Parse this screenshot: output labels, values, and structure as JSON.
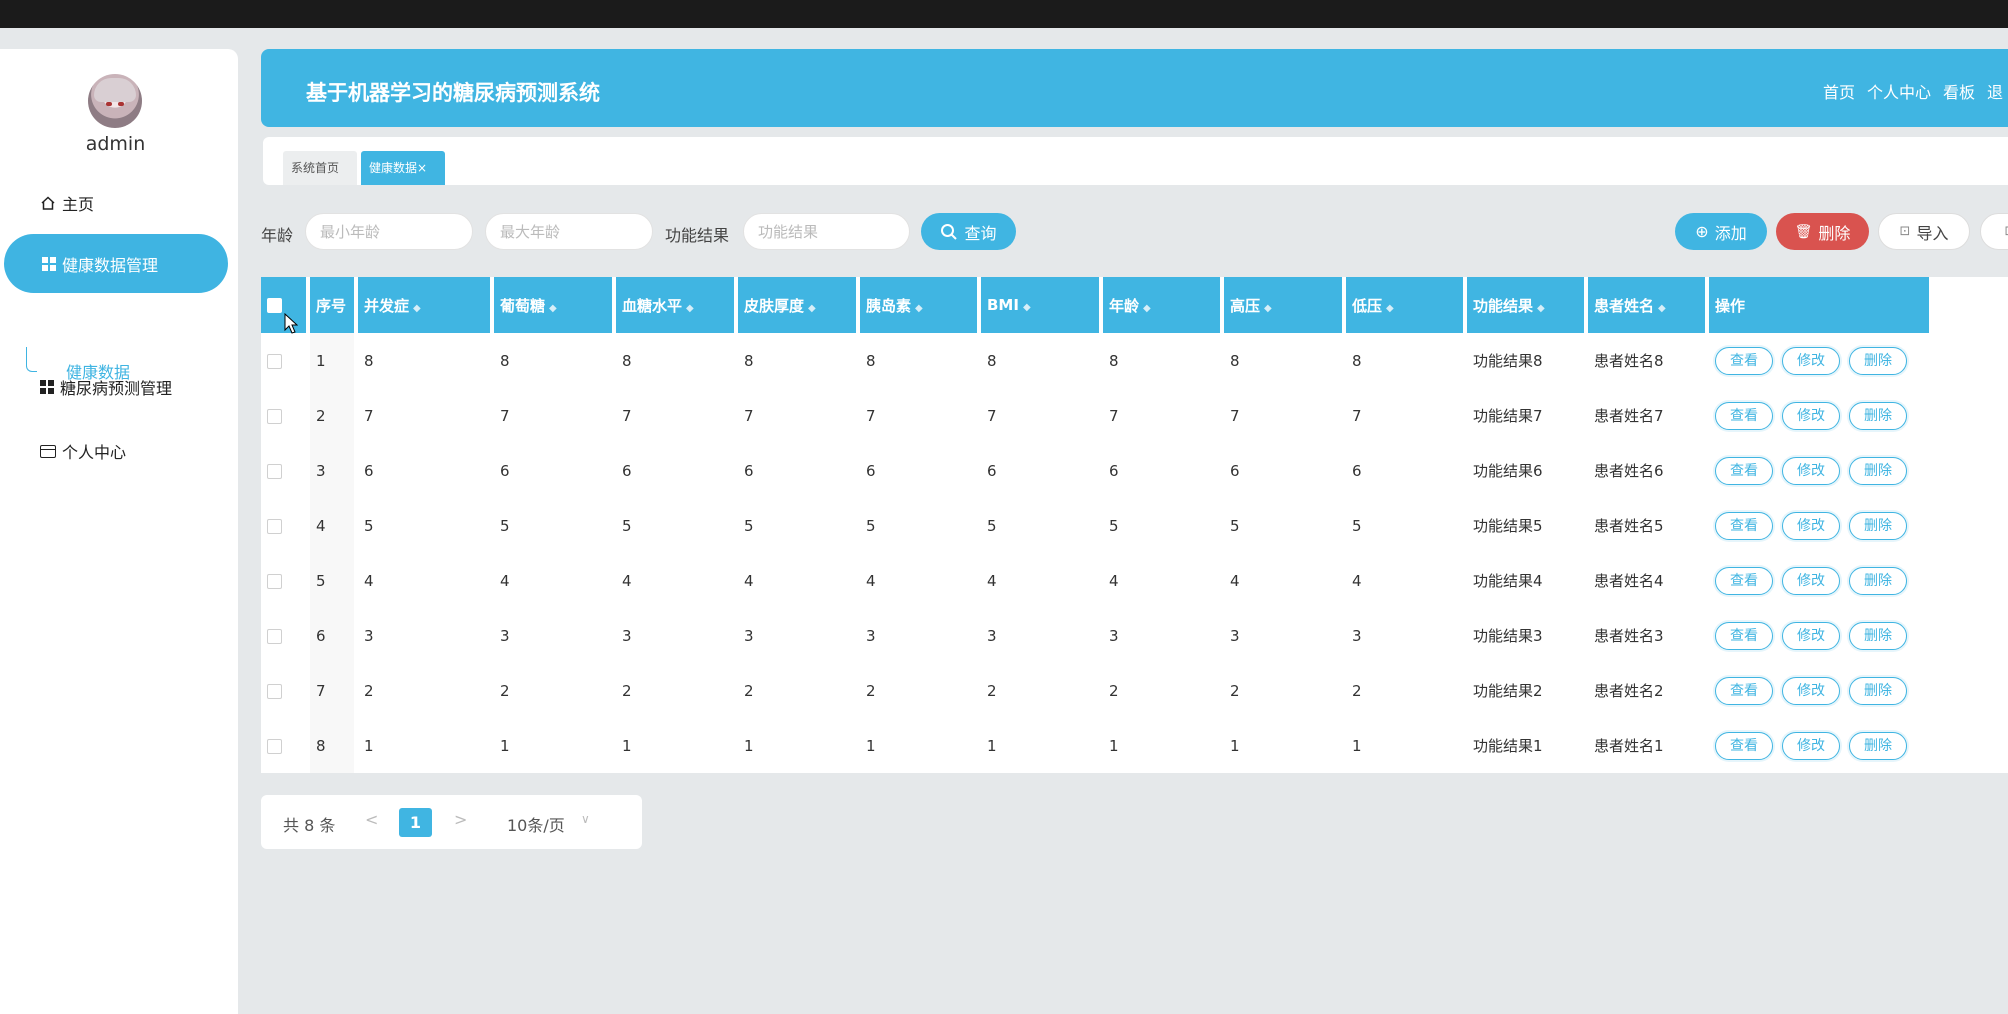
{
  "app": {
    "title": "基于机器学习的糖尿病预测系统",
    "nav": [
      "首页",
      "个人中心",
      "看板",
      "退"
    ]
  },
  "user": {
    "name": "admin"
  },
  "sidebar": {
    "items": [
      {
        "label": "主页",
        "icon": "home-icon"
      },
      {
        "label": "健康数据管理",
        "icon": "grid-icon",
        "active": true
      },
      {
        "label": "糖尿病预测管理",
        "icon": "grid-icon"
      },
      {
        "label": "个人中心",
        "icon": "card-icon"
      }
    ],
    "sub_item": "健康数据"
  },
  "tabs": [
    {
      "label": "系统首页"
    },
    {
      "label": "健康数据",
      "close": "×"
    }
  ],
  "filters": {
    "age_label": "年龄",
    "age_min_placeholder": "最小年龄",
    "age_max_placeholder": "最大年龄",
    "result_label": "功能结果",
    "result_placeholder": "功能结果",
    "query_label": "查询"
  },
  "actions": {
    "add": "添加",
    "delete": "删除",
    "import": "导入"
  },
  "table": {
    "columns": [
      "序号",
      "并发症",
      "葡萄糖",
      "血糖水平",
      "皮肤厚度",
      "胰岛素",
      "BMI",
      "年龄",
      "高压",
      "低压",
      "功能结果",
      "患者姓名",
      "操作"
    ],
    "rows": [
      [
        "1",
        "8",
        "8",
        "8",
        "8",
        "8",
        "8",
        "8",
        "8",
        "8",
        "功能结果8",
        "患者姓名8"
      ],
      [
        "2",
        "7",
        "7",
        "7",
        "7",
        "7",
        "7",
        "7",
        "7",
        "7",
        "功能结果7",
        "患者姓名7"
      ],
      [
        "3",
        "6",
        "6",
        "6",
        "6",
        "6",
        "6",
        "6",
        "6",
        "6",
        "功能结果6",
        "患者姓名6"
      ],
      [
        "4",
        "5",
        "5",
        "5",
        "5",
        "5",
        "5",
        "5",
        "5",
        "5",
        "功能结果5",
        "患者姓名5"
      ],
      [
        "5",
        "4",
        "4",
        "4",
        "4",
        "4",
        "4",
        "4",
        "4",
        "4",
        "功能结果4",
        "患者姓名4"
      ],
      [
        "6",
        "3",
        "3",
        "3",
        "3",
        "3",
        "3",
        "3",
        "3",
        "3",
        "功能结果3",
        "患者姓名3"
      ],
      [
        "7",
        "2",
        "2",
        "2",
        "2",
        "2",
        "2",
        "2",
        "2",
        "2",
        "功能结果2",
        "患者姓名2"
      ],
      [
        "8",
        "1",
        "1",
        "1",
        "1",
        "1",
        "1",
        "1",
        "1",
        "1",
        "功能结果1",
        "患者姓名1"
      ]
    ],
    "row_actions": [
      "查看",
      "修改",
      "删除"
    ]
  },
  "pagination": {
    "total": "共 8 条",
    "prev": "<",
    "current": "1",
    "next": ">",
    "page_size": "10条/页"
  },
  "colors": {
    "primary": "#40b5e2",
    "danger": "#d9534f"
  }
}
